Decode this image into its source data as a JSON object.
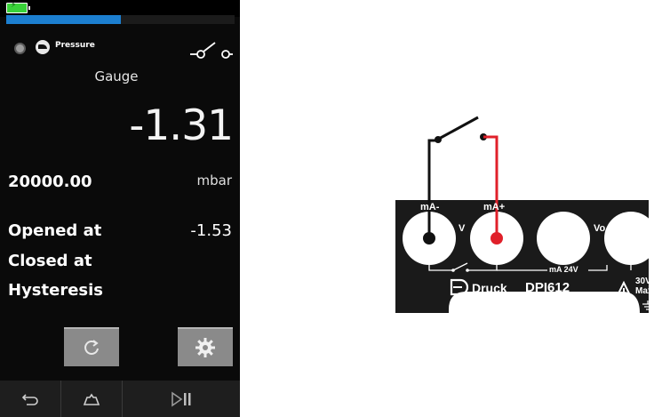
{
  "status": {
    "progress_percent": 50
  },
  "header": {
    "pressure_label": "Pressure"
  },
  "main": {
    "mode": "Gauge",
    "reading": "-1.31",
    "range": "20000.00",
    "unit": "mbar",
    "rows": [
      {
        "label": "Opened at",
        "value": "-1.53"
      },
      {
        "label": "Closed at",
        "value": ""
      },
      {
        "label": "Hysteresis",
        "value": ""
      }
    ]
  },
  "buttons": {
    "reset_icon": "reset-icon",
    "settings_icon": "gear-icon"
  },
  "nav": {
    "back_icon": "back-icon",
    "home_icon": "home-icon",
    "play_pause_icon": "play-pause-icon"
  },
  "diagram": {
    "terminal_ma_minus": "mA-",
    "terminal_ma_plus": "mA+",
    "terminal_v": "V",
    "terminal_vo": "Vo",
    "label_ma24v": "mA 24V",
    "brand": "Druck",
    "model": "DPI612",
    "max_voltage": "30V",
    "max_label": "Max"
  },
  "colors": {
    "accent": "#1c7fd0",
    "wire_red": "#e0202a",
    "panel": "#1a1a1a",
    "button": "#8a8a8a"
  }
}
